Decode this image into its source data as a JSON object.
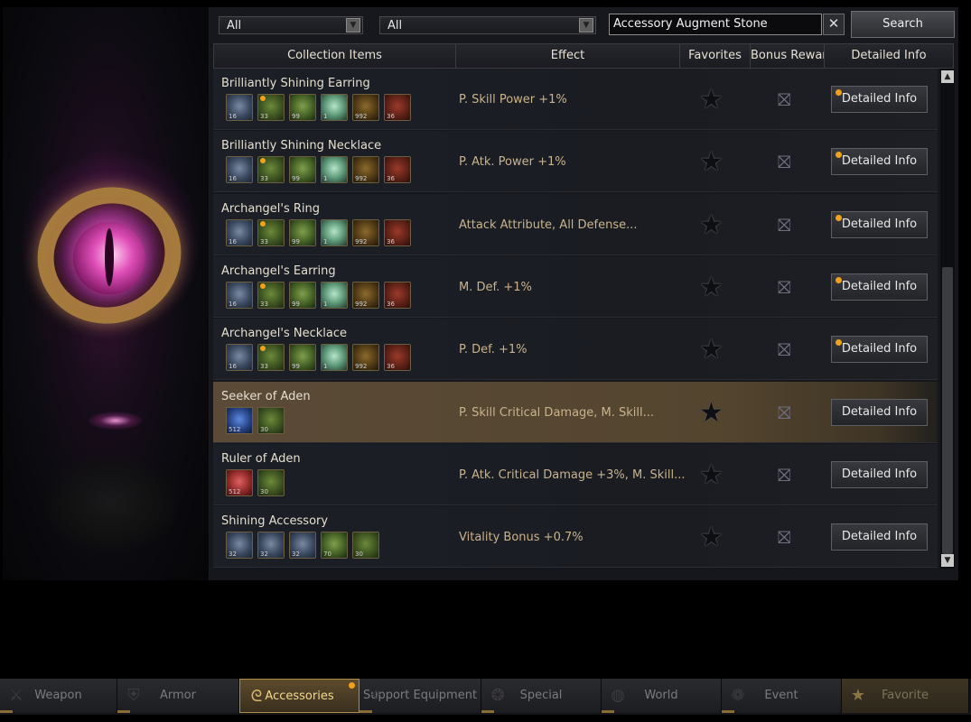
{
  "colors": {
    "accent_orange": "#f2a21a",
    "selected_row": "#5a4a37",
    "effect_text": "#c9b38c",
    "active_tab": "#5c4b2d"
  },
  "filters": {
    "select1": "All",
    "select2": "All",
    "search_value": "Accessory Augment Stone",
    "clear_label": "✕",
    "search_button": "Search"
  },
  "headers": {
    "collection_items": "Collection Items",
    "effect": "Effect",
    "favorites": "Favorites",
    "bonus_rewards": "Bonus Rewarc",
    "detailed_info": "Detailed Info"
  },
  "rows": [
    {
      "name": "Brilliantly Shining Earring",
      "effect": "P. Skill Power +1%",
      "detail_label": "Detailed Info",
      "has_notice": true,
      "selected": false,
      "materials": [
        {
          "icon": "dragon-crest",
          "qty": "16"
        },
        {
          "icon": "green-gem",
          "qty": "33",
          "dot": true
        },
        {
          "icon": "green-leaf",
          "qty": "99"
        },
        {
          "icon": "crystal",
          "qty": "1"
        },
        {
          "icon": "chest",
          "qty": "992"
        },
        {
          "icon": "red-stone",
          "qty": "36"
        }
      ]
    },
    {
      "name": "Brilliantly Shining Necklace",
      "effect": "P. Atk. Power +1%",
      "detail_label": "Detailed Info",
      "has_notice": true,
      "selected": false,
      "materials": [
        {
          "icon": "dragon-crest",
          "qty": "16"
        },
        {
          "icon": "green-gem",
          "qty": "33",
          "dot": true
        },
        {
          "icon": "green-leaf",
          "qty": "99"
        },
        {
          "icon": "crystal",
          "qty": "1"
        },
        {
          "icon": "chest",
          "qty": "992"
        },
        {
          "icon": "red-stone",
          "qty": "36"
        }
      ]
    },
    {
      "name": "Archangel's Ring",
      "effect": "Attack Attribute, All Defense...",
      "detail_label": "Detailed Info",
      "has_notice": true,
      "selected": false,
      "materials": [
        {
          "icon": "dragon-crest",
          "qty": "16"
        },
        {
          "icon": "green-gem",
          "qty": "33",
          "dot": true
        },
        {
          "icon": "green-leaf",
          "qty": "99"
        },
        {
          "icon": "crystal",
          "qty": "1"
        },
        {
          "icon": "chest",
          "qty": "992"
        },
        {
          "icon": "red-stone",
          "qty": "36"
        }
      ]
    },
    {
      "name": "Archangel's Earring",
      "effect": "M. Def. +1%",
      "detail_label": "Detailed Info",
      "has_notice": true,
      "selected": false,
      "materials": [
        {
          "icon": "dragon-crest",
          "qty": "16"
        },
        {
          "icon": "green-gem",
          "qty": "33",
          "dot": true
        },
        {
          "icon": "green-leaf",
          "qty": "99"
        },
        {
          "icon": "crystal",
          "qty": "1"
        },
        {
          "icon": "chest",
          "qty": "992"
        },
        {
          "icon": "red-stone",
          "qty": "36"
        }
      ]
    },
    {
      "name": "Archangel's Necklace",
      "effect": "P. Def. +1%",
      "detail_label": "Detailed Info",
      "has_notice": true,
      "selected": false,
      "materials": [
        {
          "icon": "dragon-crest",
          "qty": "16"
        },
        {
          "icon": "green-gem",
          "qty": "33",
          "dot": true
        },
        {
          "icon": "green-leaf",
          "qty": "99"
        },
        {
          "icon": "crystal",
          "qty": "1"
        },
        {
          "icon": "chest",
          "qty": "992"
        },
        {
          "icon": "red-stone",
          "qty": "36"
        }
      ]
    },
    {
      "name": "Seeker of Aden",
      "effect": "P. Skill Critical Damage, M. Skill...",
      "detail_label": "Detailed Info",
      "has_notice": false,
      "selected": true,
      "materials": [
        {
          "icon": "blue-rose",
          "qty": "512"
        },
        {
          "icon": "green-gem",
          "qty": "30"
        }
      ]
    },
    {
      "name": "Ruler of Aden",
      "effect": "P. Atk. Critical Damage +3%, M. Skill...",
      "detail_label": "Detailed Info",
      "has_notice": false,
      "selected": false,
      "materials": [
        {
          "icon": "red-rose",
          "qty": "512"
        },
        {
          "icon": "green-gem",
          "qty": "30"
        }
      ]
    },
    {
      "name": "Shining Accessory",
      "effect": "Vitality Bonus +0.7%",
      "detail_label": "Detailed Info",
      "has_notice": false,
      "selected": false,
      "materials": [
        {
          "icon": "dragon-crest",
          "qty": "32"
        },
        {
          "icon": "dragon-crest",
          "qty": "32"
        },
        {
          "icon": "dragon-crest",
          "qty": "32"
        },
        {
          "icon": "green-leaf",
          "qty": "70"
        },
        {
          "icon": "green-gem",
          "qty": "30"
        }
      ]
    }
  ],
  "tabs": [
    {
      "label": "Weapon",
      "icon": "sword-icon",
      "glyph": "⚔",
      "active": false
    },
    {
      "label": "Armor",
      "icon": "shield-icon",
      "glyph": "⛨",
      "active": false
    },
    {
      "label": "Accessories",
      "icon": "necklace-icon",
      "glyph": "ᘓ",
      "active": true,
      "notice": true
    },
    {
      "label": "Support Equipment",
      "icon": "support-icon",
      "glyph": "✧",
      "active": false
    },
    {
      "label": "Special",
      "icon": "special-icon",
      "glyph": "❂",
      "active": false
    },
    {
      "label": "World",
      "icon": "globe-icon",
      "glyph": "◍",
      "active": false
    },
    {
      "label": "Event",
      "icon": "event-icon",
      "glyph": "❁",
      "active": false
    },
    {
      "label": "Favorite",
      "icon": "star-icon",
      "glyph": "★",
      "active": false,
      "fav": true
    }
  ],
  "scrollbar": {
    "up": "▲",
    "down": "▼"
  },
  "favorite_glyph": "★",
  "gift_glyph": "⛝"
}
